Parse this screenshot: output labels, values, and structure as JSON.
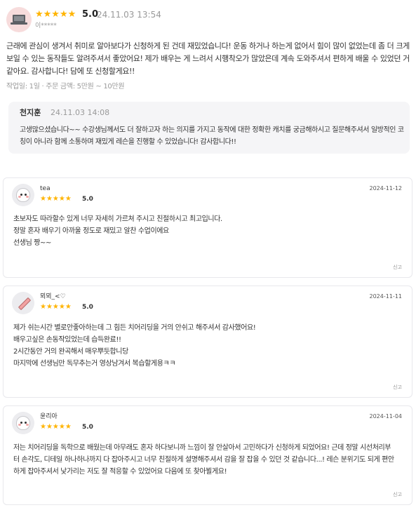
{
  "top_review": {
    "rating": "5.0",
    "stars": "★★★★★",
    "date": "24.11.03 13:54",
    "user": "이*****",
    "body": "근래에 관심이 생겨서 취미로 알아보다가 신청하게 된 건데 재밌었습니다! 운동 하거나 하는게 없어서 힘이 많이 없었는데 좀 더 크게 보일 수 있는 동작들도 알려주셔서 좋았어요!  제가 배우는 게 느려서 시행착오가 많았은데 계속 도와주셔서 편하게 배울 수 있었던 거 같아요. 감사합니다! 담에 또 신청할게요!!",
    "meta": "작업일: 1일  ·  주문 금액: 5만원 ~ 10만원",
    "reply": {
      "name": "천지훈",
      "date": "24.11.03 14:08",
      "body": "고생많으셨습니다~~ 수강생님께서도 더 잘하고자 하는 의지를 가지고 동작에 대한 정확한 캐치를 궁금해하시고 질문해주셔서 일방적인 코칭이 아니라 함께 소통하며 재밌게 레슨을 진행할 수 있었습니다! 감사합니다!!"
    }
  },
  "reviews": [
    {
      "name": "tea",
      "stars": "★★★★★",
      "rating": "5.0",
      "date": "2024-11-12",
      "lines": [
        "초보자도 따라할수 있게 너무 자세히 가르쳐 주시고 친절하시고 최고입니다.",
        "정말 혼자 배우기 아까울 정도로 재밌고 알찬 수업이에요",
        "선생님 짱~~"
      ],
      "report": "신고"
    },
    {
      "name": "뫼뫼_<♡",
      "stars": "★★★★★",
      "rating": "5.0",
      "date": "2024-11-11",
      "lines": [
        "제가 쉬는시간 별로안좋아하는데 그 힘든 치어리딩을 거의 안쉬고 해주셔서 감사했어요!",
        "배우고싶은 손동작있었는데 습득완료!!",
        "2시간동안 거의 완곡해서 매우뿌듯합니당",
        "마지막에 선생님만 독무추는거 영상남겨서 복습할게용ㅋㅋ"
      ],
      "report": "신고"
    },
    {
      "name": "윤리아",
      "stars": "★★★★★",
      "rating": "5.0",
      "date": "2024-11-04",
      "lines": [
        "저는 치어리딩을 독학으로 배웠는데 아무래도 혼자 하다보니까 느낌이 잘 안살아서 고민하다가 신청하게 되었어요! 근데 정말 시선처리부",
        "터 손각도, 디테일 하나하나까지 다 잡아주시고 너무 친절하게 설명해주셔서 감을 잘 잡을 수 있던 것 같습니다...! 레슨 분위기도 되게 편안",
        "하게 잡아주셔서 낯가리는 저도 잘 적응할 수 있었어요 다음에 또 찾아뵐게요!"
      ],
      "report": "신고"
    }
  ]
}
